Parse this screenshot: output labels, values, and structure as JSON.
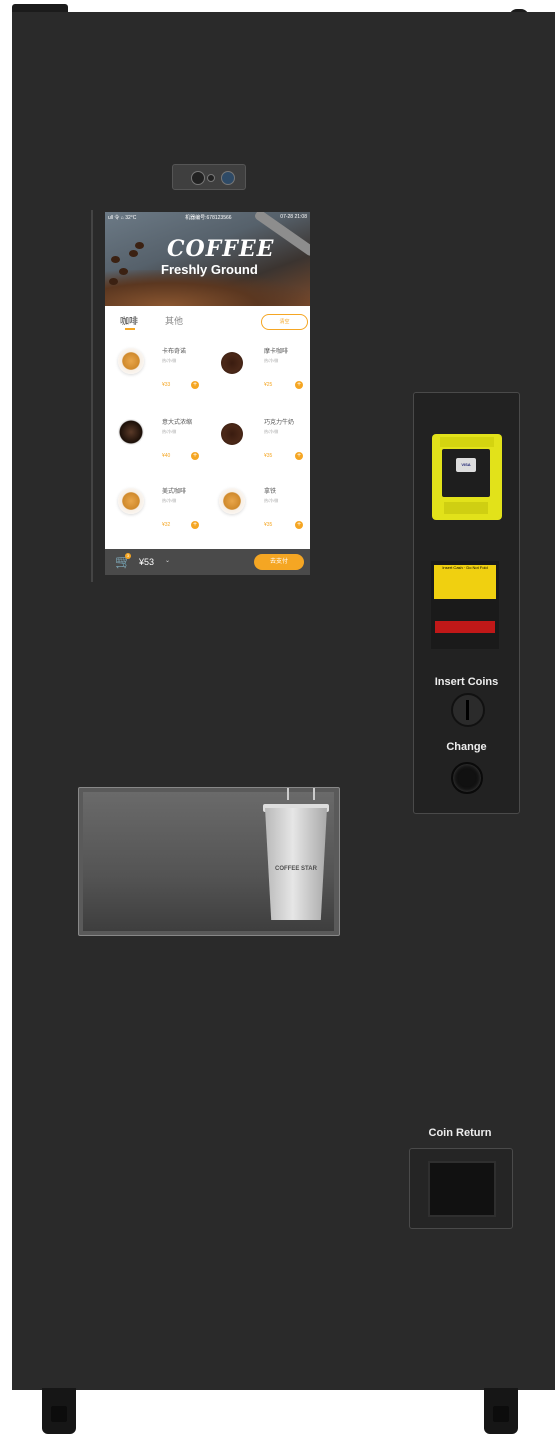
{
  "screen": {
    "status": {
      "signal": "ull 令 ⌂ 32°C",
      "machine_id": "机器编号:678123566",
      "datetime": "07-28 21:08"
    },
    "hero": {
      "title": "COFFEE",
      "subtitle": "Freshly Ground"
    },
    "tabs": [
      {
        "label": "咖啡"
      },
      {
        "label": "其他"
      }
    ],
    "tab_button": "清空",
    "products": [
      {
        "name": "卡布奇诺",
        "desc": "热/冷/微",
        "price": "¥33",
        "cup": "latte"
      },
      {
        "name": "摩卡咖啡",
        "desc": "热/冷/微",
        "price": "¥25",
        "cup": "dark"
      },
      {
        "name": "意大式浓缩",
        "desc": "热/冷/微",
        "price": "¥40",
        "cup": "black"
      },
      {
        "name": "巧克力牛奶",
        "desc": "热/冷/微",
        "price": "¥35",
        "cup": "dark"
      },
      {
        "name": "美式咖啡",
        "desc": "热/冷/微",
        "price": "¥32",
        "cup": "latte"
      },
      {
        "name": "拿铁",
        "desc": "热/冷/微",
        "price": "¥35",
        "cup": "latte"
      }
    ],
    "cart": {
      "badge": "3",
      "total": "¥53",
      "pay_label": "去支付"
    }
  },
  "card_reader": {
    "logo": "VISA"
  },
  "bill_acceptor": {
    "label": "Insert Cash · Do Not Fold"
  },
  "panel": {
    "insert_coins": "Insert Coins",
    "change": "Change"
  },
  "dispenser": {
    "cup_text": "COFFEE STAR"
  },
  "coin_return": {
    "label": "Coin Return"
  },
  "colors": {
    "body": "#2a2a2a",
    "accent": "#f5a623",
    "reader": "#e2e21a",
    "bill_slot": "#c01818"
  },
  "icons": [
    "camera-icon",
    "cart-icon",
    "add-icon",
    "chevron-down-icon"
  ]
}
